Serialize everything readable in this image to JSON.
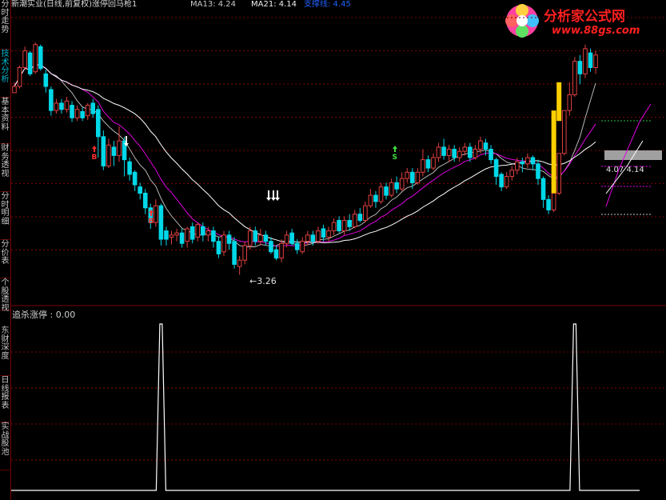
{
  "header": {
    "title": "新潮实业(日线,前复权)涨停回马枪1",
    "ma13": "MA13: 4.24",
    "ma21": "MA21: 4.14",
    "extra": "支撑线: 4.45"
  },
  "side_tabs": [
    {
      "label": "分时走势"
    },
    {
      "label": "技术分析"
    },
    {
      "label": "基本资料"
    },
    {
      "label": "财务透视"
    },
    {
      "label": "分时明细"
    },
    {
      "label": "分价表"
    },
    {
      "label": "个股透视"
    },
    {
      "label": "东财深度"
    },
    {
      "label": "日线报表"
    },
    {
      "label": "实战股池"
    }
  ],
  "logo": {
    "text": "分析家公式网",
    "url": "www.88gs.com"
  },
  "annotations": {
    "low_label": "←3.26",
    "sell_marker": "S",
    "buy_marker": "B",
    "price_level": "4.07 4.14"
  },
  "indicator": {
    "label": "追杀涨停 : 0.00"
  },
  "colors": {
    "up": "#e04040",
    "down": "#00d8e8",
    "ma13": "#ffffff",
    "ma21": "#e000e0",
    "ma_long": "#ffffff",
    "grid": "#7a0000",
    "highlight": "#ffd000",
    "signal": "#ffffff"
  },
  "chart_data": {
    "type": "candlestick",
    "candles": [
      [
        4.72,
        4.78,
        4.75,
        4.82
      ],
      [
        4.78,
        4.96,
        4.76,
        4.98
      ],
      [
        4.96,
        5.12,
        4.94,
        5.16
      ],
      [
        5.1,
        4.9,
        4.88,
        5.12
      ],
      [
        4.92,
        5.18,
        4.9,
        5.2
      ],
      [
        5.16,
        4.95,
        4.93,
        5.18
      ],
      [
        4.9,
        4.78,
        4.72,
        4.94
      ],
      [
        4.75,
        4.55,
        4.5,
        4.78
      ],
      [
        4.55,
        4.62,
        4.52,
        4.66
      ],
      [
        4.62,
        4.56,
        4.52,
        4.66
      ],
      [
        4.56,
        4.64,
        4.53,
        4.68
      ],
      [
        4.6,
        4.48,
        4.44,
        4.64
      ],
      [
        4.48,
        4.56,
        4.45,
        4.6
      ],
      [
        4.54,
        4.48,
        4.45,
        4.58
      ],
      [
        4.5,
        4.6,
        4.46,
        4.62
      ],
      [
        4.62,
        4.52,
        4.48,
        4.66
      ],
      [
        4.56,
        4.3,
        4.1,
        4.6
      ],
      [
        4.3,
        4.02,
        3.98,
        4.36
      ],
      [
        4.02,
        4.22,
        4.0,
        4.28
      ],
      [
        4.2,
        4.12,
        4.02,
        4.26
      ],
      [
        4.12,
        4.26,
        4.06,
        4.4
      ],
      [
        4.26,
        4.08,
        3.92,
        4.3
      ],
      [
        4.06,
        3.94,
        3.88,
        4.1
      ],
      [
        3.96,
        3.84,
        3.78,
        3.98
      ],
      [
        3.82,
        3.76,
        3.7,
        3.86
      ],
      [
        3.76,
        3.62,
        3.56,
        3.8
      ],
      [
        3.62,
        3.48,
        3.42,
        3.66
      ],
      [
        3.48,
        3.64,
        3.44,
        3.7
      ],
      [
        3.64,
        3.32,
        3.26,
        3.66
      ],
      [
        3.4,
        3.32,
        3.26,
        3.44
      ],
      [
        3.34,
        3.36,
        3.27,
        3.4
      ],
      [
        3.36,
        3.38,
        3.3,
        3.42
      ],
      [
        3.38,
        3.28,
        3.24,
        3.42
      ],
      [
        3.3,
        3.42,
        3.24,
        3.44
      ],
      [
        3.44,
        3.32,
        3.28,
        3.48
      ],
      [
        3.34,
        3.46,
        3.3,
        3.48
      ],
      [
        3.44,
        3.36,
        3.3,
        3.48
      ],
      [
        3.36,
        3.4,
        3.3,
        3.44
      ],
      [
        3.4,
        3.3,
        3.24,
        3.44
      ],
      [
        3.3,
        3.18,
        3.14,
        3.34
      ],
      [
        3.2,
        3.36,
        3.16,
        3.4
      ],
      [
        3.36,
        3.28,
        3.22,
        3.4
      ],
      [
        3.3,
        3.08,
        3.04,
        3.34
      ],
      [
        3.06,
        3.12,
        2.98,
        3.16
      ],
      [
        3.12,
        3.26,
        3.08,
        3.3
      ],
      [
        3.26,
        3.4,
        3.22,
        3.44
      ],
      [
        3.4,
        3.3,
        3.26,
        3.44
      ],
      [
        3.3,
        3.36,
        3.26,
        3.42
      ],
      [
        3.36,
        3.3,
        3.26,
        3.4
      ],
      [
        3.3,
        3.2,
        3.18,
        3.34
      ],
      [
        3.22,
        3.14,
        3.12,
        3.26
      ],
      [
        3.14,
        3.28,
        3.1,
        3.32
      ],
      [
        3.28,
        3.36,
        3.24,
        3.4
      ],
      [
        3.38,
        3.28,
        3.26,
        3.42
      ],
      [
        3.28,
        3.22,
        3.18,
        3.32
      ],
      [
        3.2,
        3.3,
        3.18,
        3.34
      ],
      [
        3.3,
        3.36,
        3.26,
        3.4
      ],
      [
        3.36,
        3.3,
        3.26,
        3.4
      ],
      [
        3.3,
        3.4,
        3.28,
        3.44
      ],
      [
        3.42,
        3.34,
        3.3,
        3.46
      ],
      [
        3.34,
        3.4,
        3.3,
        3.44
      ],
      [
        3.4,
        3.48,
        3.36,
        3.52
      ],
      [
        3.5,
        3.4,
        3.38,
        3.54
      ],
      [
        3.4,
        3.5,
        3.36,
        3.54
      ],
      [
        3.5,
        3.44,
        3.4,
        3.56
      ],
      [
        3.44,
        3.56,
        3.42,
        3.6
      ],
      [
        3.56,
        3.5,
        3.48,
        3.62
      ],
      [
        3.5,
        3.64,
        3.48,
        3.68
      ],
      [
        3.64,
        3.74,
        3.62,
        3.8
      ],
      [
        3.74,
        3.68,
        3.62,
        3.78
      ],
      [
        3.68,
        3.82,
        3.66,
        3.86
      ],
      [
        3.82,
        3.74,
        3.7,
        3.86
      ],
      [
        3.74,
        3.86,
        3.72,
        3.9
      ],
      [
        3.86,
        3.8,
        3.76,
        3.92
      ],
      [
        3.8,
        3.9,
        3.78,
        3.96
      ],
      [
        3.9,
        3.96,
        3.86,
        4.0
      ],
      [
        3.96,
        3.86,
        3.8,
        4.0
      ],
      [
        3.86,
        3.96,
        3.84,
        4.0
      ],
      [
        3.96,
        4.08,
        3.92,
        4.18
      ],
      [
        4.08,
        4.0,
        3.96,
        4.12
      ],
      [
        4.0,
        4.1,
        3.98,
        4.14
      ],
      [
        4.1,
        4.2,
        4.06,
        4.24
      ],
      [
        4.2,
        4.12,
        4.08,
        4.28
      ],
      [
        4.12,
        4.18,
        4.06,
        4.22
      ],
      [
        4.18,
        4.1,
        4.06,
        4.22
      ],
      [
        4.1,
        4.16,
        4.06,
        4.2
      ],
      [
        4.16,
        4.2,
        4.12,
        4.24
      ],
      [
        4.2,
        4.1,
        4.06,
        4.24
      ],
      [
        4.1,
        4.18,
        4.08,
        4.22
      ],
      [
        4.18,
        4.26,
        4.14,
        4.3
      ],
      [
        4.24,
        4.18,
        4.12,
        4.28
      ],
      [
        4.18,
        4.08,
        4.04,
        4.22
      ],
      [
        4.08,
        3.92,
        3.84,
        4.1
      ],
      [
        3.94,
        3.82,
        3.78,
        3.96
      ],
      [
        3.82,
        3.92,
        3.8,
        3.96
      ],
      [
        3.92,
        3.98,
        3.88,
        4.02
      ],
      [
        3.98,
        4.06,
        3.94,
        4.1
      ],
      [
        4.06,
        4.04,
        3.96,
        4.1
      ],
      [
        4.04,
        4.1,
        4.0,
        4.14
      ],
      [
        4.1,
        4.04,
        3.98,
        4.12
      ],
      [
        4.04,
        3.9,
        3.84,
        4.08
      ],
      [
        3.9,
        3.7,
        3.62,
        3.92
      ],
      [
        3.7,
        3.6,
        3.56,
        3.74
      ],
      [
        3.6,
        3.76,
        3.58,
        3.8
      ],
      [
        3.76,
        4.14,
        3.74,
        4.14
      ],
      [
        4.14,
        4.55,
        4.12,
        4.55
      ],
      [
        4.55,
        4.7,
        4.5,
        4.82
      ],
      [
        4.7,
        5.02,
        4.68,
        5.06
      ],
      [
        5.02,
        4.9,
        4.8,
        5.08
      ],
      [
        4.9,
        5.14,
        4.86,
        5.18
      ],
      [
        5.1,
        4.96,
        4.92,
        5.14
      ],
      [
        4.96,
        5.08,
        4.9,
        5.12
      ]
    ],
    "indicator_values_peaks": [
      {
        "index": 28,
        "value": 1
      },
      {
        "index": 107,
        "value": 1
      }
    ],
    "indicator_name": "追杀涨停",
    "ylim": [
      2.9,
      5.3
    ]
  }
}
